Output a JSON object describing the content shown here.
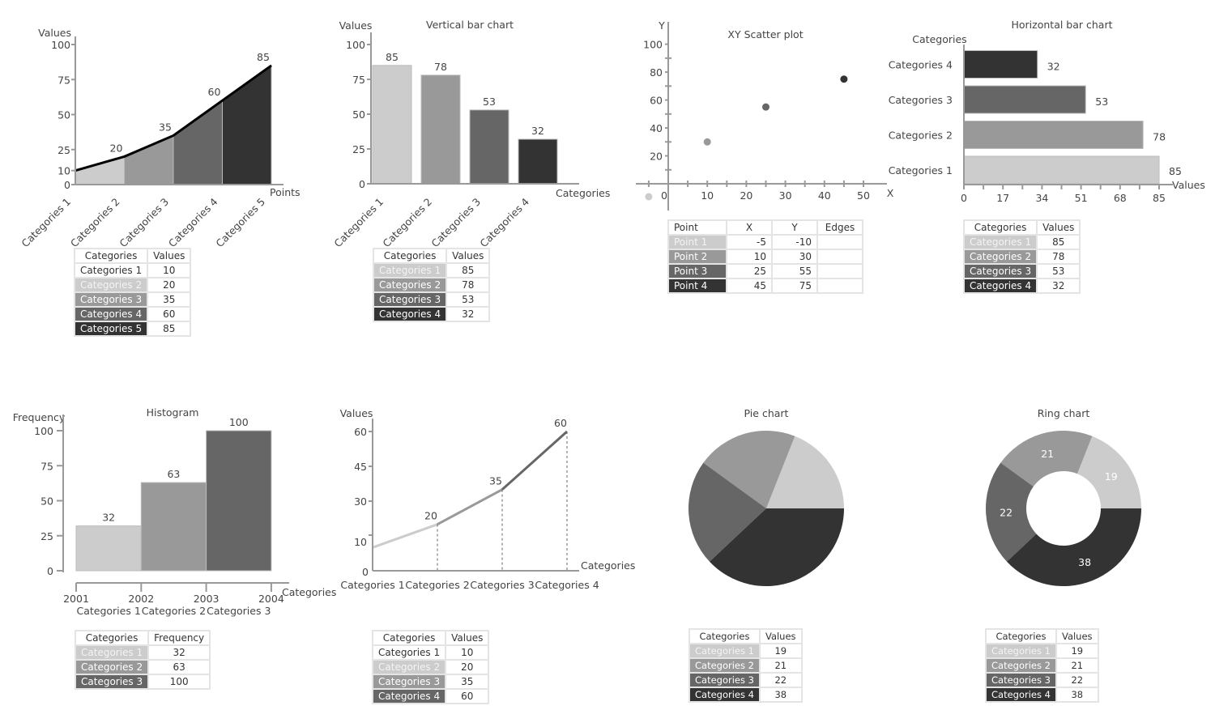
{
  "palette": {
    "c1": "#cccccc",
    "c2": "#999999",
    "c3": "#666666",
    "c4": "#333333",
    "axis": "#999999",
    "text": "#444444",
    "white": "#ffffff"
  },
  "chart_data": [
    {
      "id": "area",
      "type": "area",
      "title": "",
      "xlabel": "Points",
      "ylabel": "Values",
      "categories": [
        "Categories 1",
        "Categories 2",
        "Categories 3",
        "Categories 4",
        "Categories 5"
      ],
      "values": [
        10,
        20,
        35,
        60,
        85
      ],
      "yticks": [
        0,
        10,
        25,
        50,
        75,
        100
      ],
      "ylim": [
        0,
        100
      ],
      "grid": false,
      "table": {
        "headers": [
          "Categories",
          "Values"
        ],
        "rows": [
          [
            "Categories 1",
            "10"
          ],
          [
            "Categories 2",
            "20"
          ],
          [
            "Categories 3",
            "35"
          ],
          [
            "Categories 4",
            "60"
          ],
          [
            "Categories 5",
            "85"
          ]
        ],
        "row_colors": [
          "#ffffff",
          "#cccccc",
          "#999999",
          "#666666",
          "#333333"
        ]
      }
    },
    {
      "id": "vbar",
      "type": "bar",
      "title": "Vertical bar chart",
      "xlabel": "Categories",
      "ylabel": "Values",
      "categories": [
        "Categories 1",
        "Categories 2",
        "Categories 3",
        "Categories 4"
      ],
      "values": [
        85,
        78,
        53,
        32
      ],
      "yticks": [
        0,
        25,
        50,
        75,
        100
      ],
      "ylim": [
        0,
        100
      ],
      "grid": false,
      "table": {
        "headers": [
          "Categories",
          "Values"
        ],
        "rows": [
          [
            "Categories 1",
            "85"
          ],
          [
            "Categories 2",
            "78"
          ],
          [
            "Categories 3",
            "53"
          ],
          [
            "Categories 4",
            "32"
          ]
        ],
        "row_colors": [
          "#cccccc",
          "#999999",
          "#666666",
          "#333333"
        ]
      }
    },
    {
      "id": "scatter",
      "type": "scatter",
      "title": "XY Scatter plot",
      "xlabel": "X",
      "ylabel": "Y",
      "points": [
        {
          "name": "Point 1",
          "x": -5,
          "y": -10
        },
        {
          "name": "Point 2",
          "x": 10,
          "y": 30
        },
        {
          "name": "Point 3",
          "x": 25,
          "y": 55
        },
        {
          "name": "Point 4",
          "x": 45,
          "y": 75
        }
      ],
      "xticks": [
        0,
        10,
        20,
        30,
        40,
        50
      ],
      "yticks": [
        20,
        40,
        60,
        80,
        100
      ],
      "xlim": [
        -7,
        55
      ],
      "ylim": [
        -15,
        105
      ],
      "grid": false,
      "table": {
        "headers": [
          "Point",
          "X",
          "Y",
          "Edges"
        ],
        "rows": [
          [
            "Point 1",
            "-5",
            "-10",
            ""
          ],
          [
            "Point 2",
            "10",
            "30",
            ""
          ],
          [
            "Point 3",
            "25",
            "55",
            ""
          ],
          [
            "Point 4",
            "45",
            "75",
            ""
          ]
        ],
        "row_colors": [
          "#cccccc",
          "#999999",
          "#666666",
          "#333333"
        ]
      }
    },
    {
      "id": "hbar",
      "type": "bar",
      "orientation": "horizontal",
      "title": "Horizontal bar chart",
      "xlabel": "Values",
      "ylabel": "Categories",
      "categories": [
        "Categories 1",
        "Categories 2",
        "Categories 3",
        "Categories 4"
      ],
      "values": [
        85,
        78,
        53,
        32
      ],
      "xticks": [
        0,
        17,
        34,
        51,
        68,
        85
      ],
      "xlim": [
        0,
        85
      ],
      "grid": false,
      "table": {
        "headers": [
          "Categories",
          "Values"
        ],
        "rows": [
          [
            "Categories 1",
            "85"
          ],
          [
            "Categories 2",
            "78"
          ],
          [
            "Categories 3",
            "53"
          ],
          [
            "Categories 4",
            "32"
          ]
        ],
        "row_colors": [
          "#cccccc",
          "#999999",
          "#666666",
          "#333333"
        ]
      }
    },
    {
      "id": "hist",
      "type": "bar",
      "subtype": "histogram",
      "title": "Histogram",
      "xlabel": "Categories",
      "ylabel": "Frequency",
      "bins": [
        "2001",
        "2002",
        "2003",
        "2004"
      ],
      "categories": [
        "Categories 1",
        "Categories 2",
        "Categories 3"
      ],
      "values": [
        32,
        63,
        100
      ],
      "yticks": [
        0,
        25,
        50,
        75,
        100
      ],
      "ylim": [
        0,
        100
      ],
      "grid": false,
      "table": {
        "headers": [
          "Categories",
          "Frequency"
        ],
        "rows": [
          [
            "Categories 1",
            "32"
          ],
          [
            "Categories 2",
            "63"
          ],
          [
            "Categories 3",
            "100"
          ]
        ],
        "row_colors": [
          "#cccccc",
          "#999999",
          "#666666"
        ]
      }
    },
    {
      "id": "line",
      "type": "line",
      "title": "",
      "xlabel": "Categories",
      "ylabel": "Values",
      "categories": [
        "Categories 1",
        "Categories 2",
        "Categories 3",
        "Categories 4"
      ],
      "values": [
        10,
        20,
        35,
        60
      ],
      "yticks": [
        0,
        10,
        30,
        45,
        60
      ],
      "ylim": [
        0,
        60
      ],
      "grid": false,
      "table": {
        "headers": [
          "Categories",
          "Values"
        ],
        "rows": [
          [
            "Categories 1",
            "10"
          ],
          [
            "Categories 2",
            "20"
          ],
          [
            "Categories 3",
            "35"
          ],
          [
            "Categories 4",
            "60"
          ]
        ],
        "row_colors": [
          "#ffffff",
          "#cccccc",
          "#999999",
          "#666666"
        ]
      }
    },
    {
      "id": "pie",
      "type": "pie",
      "title": "Pie chart",
      "categories": [
        "Categories 1",
        "Categories 2",
        "Categories 3",
        "Categories 4"
      ],
      "values": [
        19,
        21,
        22,
        38
      ],
      "show_labels": false,
      "table": {
        "headers": [
          "Categories",
          "Values"
        ],
        "rows": [
          [
            "Categories 1",
            "19"
          ],
          [
            "Categories 2",
            "21"
          ],
          [
            "Categories 3",
            "22"
          ],
          [
            "Categories 4",
            "38"
          ]
        ],
        "row_colors": [
          "#cccccc",
          "#999999",
          "#666666",
          "#333333"
        ]
      }
    },
    {
      "id": "ring",
      "type": "pie",
      "subtype": "ring",
      "title": "Ring chart",
      "categories": [
        "Categories 1",
        "Categories 2",
        "Categories 3",
        "Categories 4"
      ],
      "values": [
        19,
        21,
        22,
        38
      ],
      "show_labels": true,
      "table": {
        "headers": [
          "Categories",
          "Values"
        ],
        "rows": [
          [
            "Categories 1",
            "19"
          ],
          [
            "Categories 2",
            "21"
          ],
          [
            "Categories 3",
            "22"
          ],
          [
            "Categories 4",
            "38"
          ]
        ],
        "row_colors": [
          "#cccccc",
          "#999999",
          "#666666",
          "#333333"
        ]
      }
    }
  ]
}
